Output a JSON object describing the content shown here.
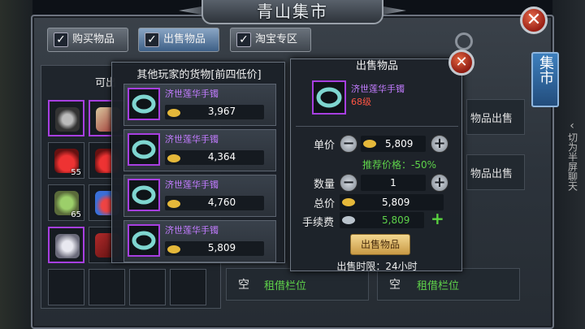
{
  "window": {
    "title": "青山集市",
    "side_tab": "集市",
    "chat_hint": "切为半屏聊天"
  },
  "tabs": [
    {
      "label": "购买物品",
      "active": false
    },
    {
      "label": "出售物品",
      "active": true
    },
    {
      "label": "淘宝专区",
      "active": false
    }
  ],
  "inventory": {
    "header": "可出",
    "slots": [
      {
        "icon": "ring-icon",
        "qty": "",
        "rare": true
      },
      {
        "icon": "red-book-icon",
        "qty": "",
        "rare": true
      },
      {
        "icon": "red-potion-icon",
        "qty": "55",
        "rare": false
      },
      {
        "icon": "red-potion-icon",
        "qty": "",
        "rare": false
      },
      {
        "icon": "food-bowl-icon",
        "qty": "65",
        "rare": false
      },
      {
        "icon": "blue-potion-icon",
        "qty": "",
        "rare": false
      },
      {
        "icon": "silver-helmet-icon",
        "qty": "",
        "rare": true
      },
      {
        "icon": "red-manual-icon",
        "qty": "",
        "rare": false
      }
    ]
  },
  "background_slots": {
    "sell_label_1": "物品出售",
    "sell_label_2": "物品出售",
    "empty_1": "空",
    "rent_1": "租借栏位",
    "empty_2": "空",
    "rent_2": "租借栏位"
  },
  "others_goods": {
    "title": "其他玩家的货物[前四低价]",
    "listings": [
      {
        "name": "济世莲华手镯",
        "price": "3,967"
      },
      {
        "name": "济世莲华手镯",
        "price": "4,364"
      },
      {
        "name": "济世莲华手镯",
        "price": "4,760"
      },
      {
        "name": "济世莲华手镯",
        "price": "5,809"
      }
    ]
  },
  "sell_dialog": {
    "title": "出售物品",
    "item_name": "济世莲华手镯",
    "item_level": "68级",
    "unit_price_label": "单价",
    "unit_price": "5,809",
    "suggest": "推荐价格：-50%",
    "quantity_label": "数量",
    "quantity": "1",
    "total_label": "总价",
    "total": "5,809",
    "fee_label": "手续费",
    "fee": "5,809",
    "sell_button": "出售物品",
    "limit": "出售时限：24小时"
  },
  "colors": {
    "rare_border": "#a73fe0",
    "item_name": "#c27cff",
    "green_text": "#5ed24a",
    "gold_button": "#e8c572"
  }
}
